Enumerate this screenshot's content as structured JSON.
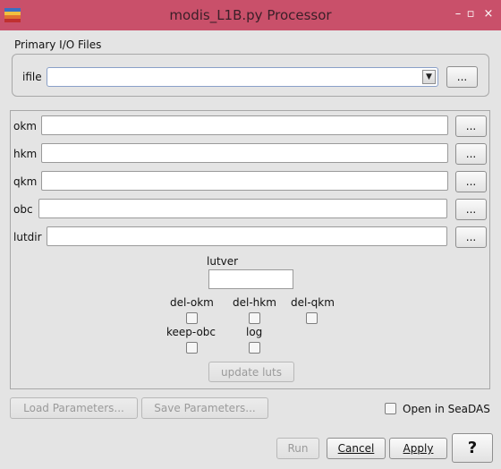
{
  "window": {
    "title": "modis_L1B.py Processor",
    "controls": [
      "–",
      "▫",
      "×"
    ]
  },
  "primary_io": {
    "section_label": "Primary I/O Files",
    "ifile_label": "ifile",
    "ifile_value": "",
    "browse_label": "..."
  },
  "files": [
    {
      "label": "okm",
      "value": "",
      "browse_label": "..."
    },
    {
      "label": "hkm",
      "value": "",
      "browse_label": "..."
    },
    {
      "label": "qkm",
      "value": "",
      "browse_label": "..."
    },
    {
      "label": "obc",
      "value": "",
      "browse_label": "..."
    },
    {
      "label": "lutdir",
      "value": "",
      "browse_label": "..."
    }
  ],
  "options": {
    "lutver_label": "lutver",
    "lutver_value": "",
    "del_okm_label": "del-okm",
    "del_okm_checked": false,
    "del_hkm_label": "del-hkm",
    "del_hkm_checked": false,
    "del_qkm_label": "del-qkm",
    "del_qkm_checked": false,
    "keep_obc_label": "keep-obc",
    "keep_obc_checked": false,
    "log_label": "log",
    "log_checked": false,
    "update_luts_label": "update luts"
  },
  "params": {
    "load_label": "Load Parameters...",
    "save_label": "Save Parameters...",
    "open_seadas_label": "Open in SeaDAS",
    "open_seadas_checked": false
  },
  "footer": {
    "run_label": "Run",
    "cancel_label": "Cancel",
    "apply_label": "Apply",
    "help_label": "?"
  },
  "colors": {
    "titlebar": "#c9506a",
    "window_bg": "#e4e4e4"
  }
}
